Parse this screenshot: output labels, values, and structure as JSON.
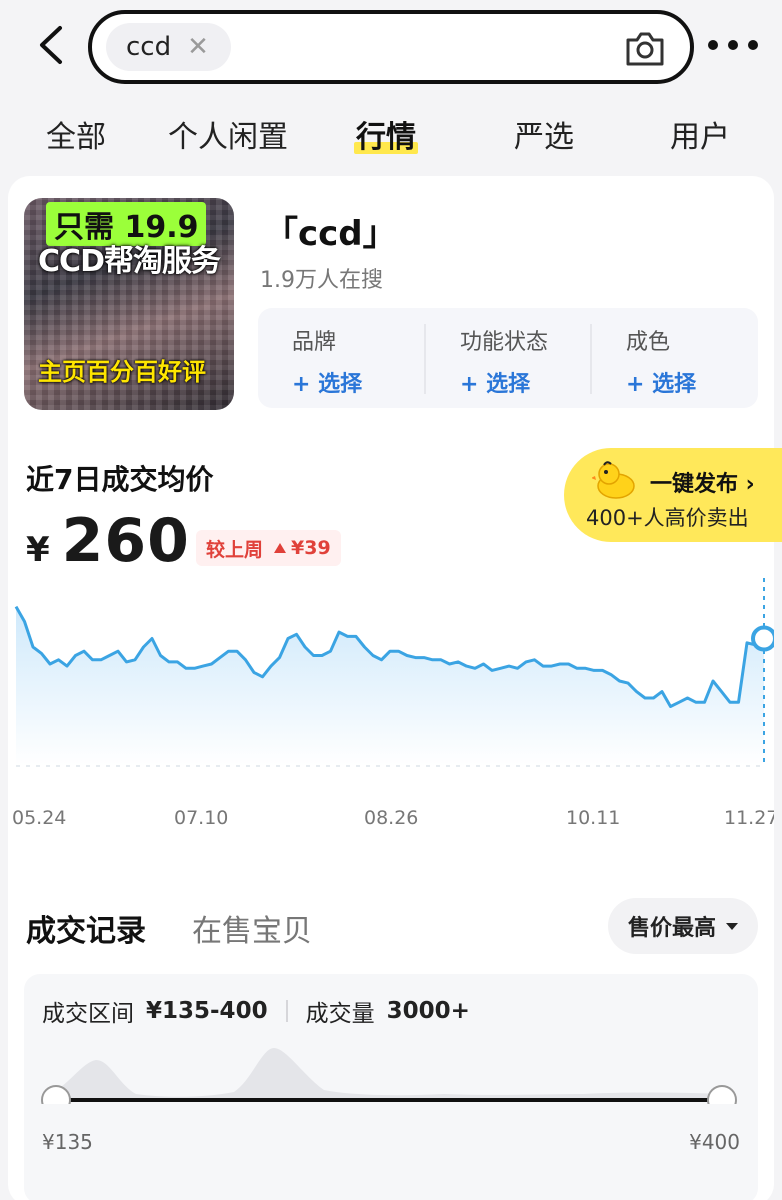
{
  "search": {
    "query": "ccd"
  },
  "tabs": [
    "全部",
    "个人闲置",
    "行情",
    "严选",
    "用户"
  ],
  "product": {
    "keyword": "「ccd」",
    "search_count": "1.9万人在搜",
    "thumb": {
      "line1": "只需 19.9",
      "line2": "CCD帮淘服务",
      "line3": "主页百分百好评"
    }
  },
  "filters": [
    {
      "label": "品牌",
      "select": "+ 选择"
    },
    {
      "label": "功能状态",
      "select": "+ 选择"
    },
    {
      "label": "成色",
      "select": "+ 选择"
    }
  ],
  "price": {
    "title": "近7日成交均价",
    "currency": "¥",
    "value": "260",
    "compare_label": "较上周",
    "compare_value": "¥39",
    "trend": "up"
  },
  "publish": {
    "title": "一键发布 ›",
    "subtitle": "400+人高价卖出"
  },
  "chart_data": {
    "type": "line",
    "x_ticks": [
      "05.24",
      "07.10",
      "08.26",
      "10.11",
      "11.27"
    ],
    "values": [
      325,
      318,
      306,
      303,
      298,
      300,
      297,
      302,
      304,
      300,
      300,
      302,
      304,
      299,
      300,
      306,
      310,
      302,
      299,
      299,
      296,
      296,
      297,
      298,
      301,
      304,
      304,
      300,
      294,
      292,
      297,
      301,
      310,
      312,
      306,
      302,
      302,
      304,
      313,
      311,
      311,
      306,
      302,
      300,
      304,
      304,
      302,
      301,
      301,
      300,
      300,
      298,
      299,
      297,
      296,
      298,
      295,
      296,
      297,
      296,
      299,
      300,
      297,
      297,
      298,
      298,
      296,
      296,
      295,
      295,
      293,
      290,
      289,
      285,
      282,
      282,
      285,
      278,
      280,
      282,
      280,
      280,
      290,
      285,
      280,
      280,
      308,
      307,
      310
    ],
    "last_value": 260,
    "color": "#3ba4e3"
  },
  "records": {
    "tab_active": "成交记录",
    "tab_inactive": "在售宝贝",
    "sort_label": "售价最高"
  },
  "range": {
    "label1": "成交区间",
    "value1": "¥135-400",
    "label2": "成交量",
    "value2": "3000+",
    "min": "¥135",
    "max": "¥400"
  }
}
